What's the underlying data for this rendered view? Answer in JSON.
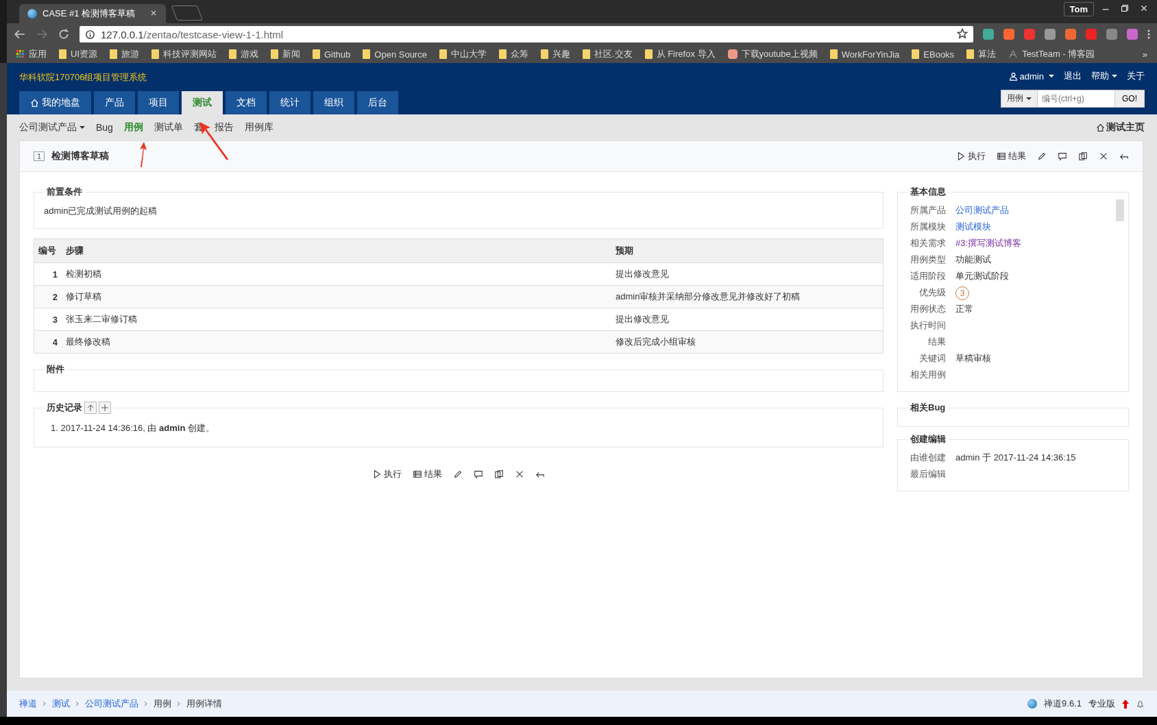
{
  "browser": {
    "tab_title": "CASE #1 检测博客草稿",
    "profile": "Tom",
    "url_host": "127.0.0.1",
    "url_path": "/zentao/testcase-view-1-1.html",
    "bookmarks": [
      {
        "kind": "apps",
        "label": "应用"
      },
      {
        "kind": "folder",
        "label": "UI资源"
      },
      {
        "kind": "folder",
        "label": "旅游"
      },
      {
        "kind": "folder",
        "label": "科技评测网站"
      },
      {
        "kind": "folder",
        "label": "游戏"
      },
      {
        "kind": "folder",
        "label": "新闻"
      },
      {
        "kind": "folder",
        "label": "Github"
      },
      {
        "kind": "folder",
        "label": "Open Source"
      },
      {
        "kind": "folder",
        "label": "中山大学"
      },
      {
        "kind": "folder",
        "label": "众筹"
      },
      {
        "kind": "folder",
        "label": "兴趣"
      },
      {
        "kind": "folder",
        "label": "社区.交友"
      },
      {
        "kind": "folder",
        "label": "从 Firefox 导入"
      },
      {
        "kind": "page",
        "label": "下载youtube上视频"
      },
      {
        "kind": "folder",
        "label": "WorkForYinJia"
      },
      {
        "kind": "folder",
        "label": "EBooks"
      },
      {
        "kind": "folder",
        "label": "算法"
      },
      {
        "kind": "site",
        "label": "TestTeam - 博客园"
      }
    ],
    "more": "»"
  },
  "header": {
    "title": "华科软院170706组项目管理系统",
    "user": "admin",
    "links": [
      "退出",
      "帮助",
      "关于"
    ],
    "search_type": "用例",
    "search_placeholder": "编号(ctrl+g)",
    "go": "GO!"
  },
  "nav": [
    {
      "label": "我的地盘",
      "kind": "home",
      "selected": false
    },
    {
      "label": "产品",
      "kind": "plain",
      "selected": false
    },
    {
      "label": "项目",
      "kind": "plain",
      "selected": false
    },
    {
      "label": "测试",
      "kind": "plain",
      "selected": true
    },
    {
      "label": "文档",
      "kind": "plain",
      "selected": false
    },
    {
      "label": "统计",
      "kind": "plain",
      "selected": false
    },
    {
      "label": "组织",
      "kind": "plain",
      "selected": false
    },
    {
      "label": "后台",
      "kind": "plain",
      "selected": false
    }
  ],
  "subnav": {
    "product": "公司测试产品",
    "items": [
      {
        "label": "Bug",
        "selected": false
      },
      {
        "label": "用例",
        "selected": true
      },
      {
        "label": "测试单",
        "selected": false
      },
      {
        "label": "套",
        "selected": false
      },
      {
        "label": "报告",
        "selected": false
      },
      {
        "label": "用例库",
        "selected": false
      }
    ],
    "home": "测试主页"
  },
  "case": {
    "id": "1",
    "title": "检测博客草稿",
    "actions": [
      {
        "kind": "run",
        "label": "执行"
      },
      {
        "kind": "result",
        "label": "结果"
      },
      {
        "kind": "edit"
      },
      {
        "kind": "comment"
      },
      {
        "kind": "copy"
      },
      {
        "kind": "delete"
      },
      {
        "kind": "back"
      }
    ],
    "bottom_actions": [
      {
        "kind": "run",
        "label": "执行"
      },
      {
        "kind": "result",
        "label": "结果"
      },
      {
        "kind": "edit"
      },
      {
        "kind": "comment"
      },
      {
        "kind": "copy"
      },
      {
        "kind": "delete"
      },
      {
        "kind": "back"
      }
    ],
    "precondition": {
      "title": "前置条件",
      "text": "admin已完成测试用例的起稿"
    },
    "steps": {
      "columns": [
        "编号",
        "步骤",
        "预期"
      ],
      "rows": [
        {
          "no": "1",
          "step": "检测初稿",
          "expect": "提出修改意见"
        },
        {
          "no": "2",
          "step": "修订草稿",
          "expect": "admin审核并采纳部分修改意见并修改好了初稿"
        },
        {
          "no": "3",
          "step": "张玉来二审修订稿",
          "expect": "提出修改意见"
        },
        {
          "no": "4",
          "step": "最终修改稿",
          "expect": "修改后完成小组审核"
        }
      ]
    },
    "attachments": {
      "title": "附件"
    },
    "history": {
      "title": "历史记录",
      "items": [
        {
          "no": "1.",
          "text": "2017-11-24 14:36:16, 由 **admin** 创建。"
        }
      ]
    }
  },
  "basic_info": {
    "title": "基本信息",
    "fields": [
      {
        "label": "所属产品",
        "kind": "link",
        "value": "公司测试产品"
      },
      {
        "label": "所属模块",
        "kind": "link",
        "value": "测试模块"
      },
      {
        "label": "相关需求",
        "kind": "visited",
        "value": "#3:撰写测试博客"
      },
      {
        "label": "用例类型",
        "kind": "text",
        "value": "功能测试"
      },
      {
        "label": "适用阶段",
        "kind": "text",
        "value": "单元测试阶段"
      },
      {
        "label": "优先级",
        "kind": "priority",
        "value": "3"
      },
      {
        "label": "用例状态",
        "kind": "text",
        "value": "正常"
      },
      {
        "label": "执行时间",
        "kind": "empty"
      },
      {
        "label": "结果",
        "kind": "empty"
      },
      {
        "label": "关键词",
        "kind": "text",
        "value": "草稿审核"
      },
      {
        "label": "相关用例",
        "kind": "empty"
      }
    ]
  },
  "related_bug": {
    "title": "相关Bug"
  },
  "create_edit": {
    "title": "创建编辑",
    "fields": [
      {
        "label": "由谁创建",
        "value": "admin 于 2017-11-24 14:36:15"
      },
      {
        "label": "最后编辑"
      }
    ]
  },
  "footer": {
    "breadcrumbs": [
      {
        "label": "禅道",
        "link": true
      },
      {
        "label": "测试",
        "link": true
      },
      {
        "label": "公司测试产品",
        "link": true
      },
      {
        "label": "用例",
        "link": false
      },
      {
        "label": "用例详情",
        "link": false
      }
    ],
    "version": "禅道9.6.1",
    "edition": "专业版"
  }
}
